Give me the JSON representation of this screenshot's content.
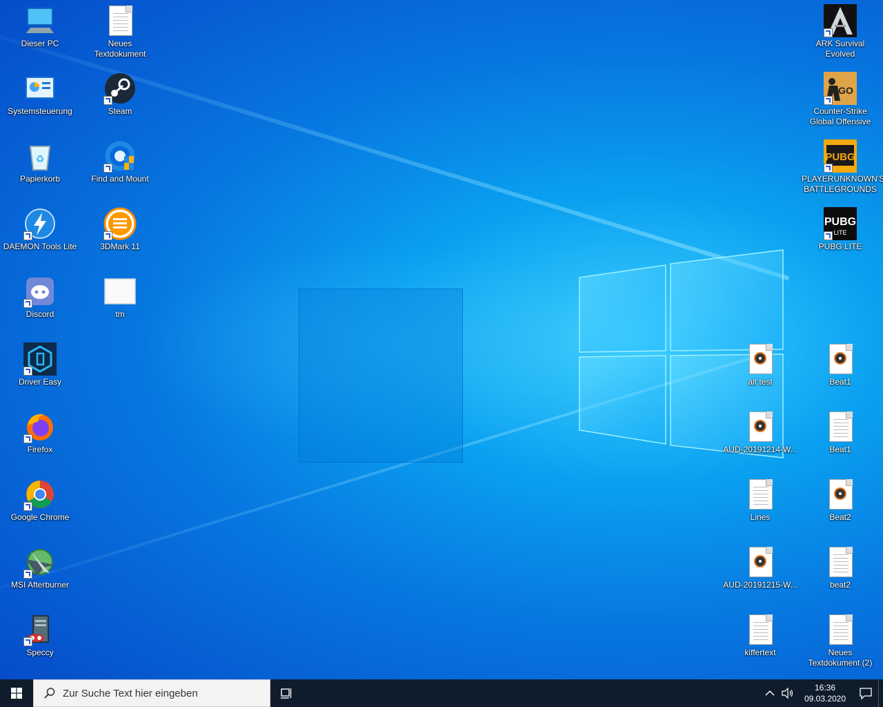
{
  "desktop": {
    "left_col1": [
      {
        "label": "Dieser PC",
        "icon": "computer-icon"
      },
      {
        "label": "Systemsteuerung",
        "icon": "control-panel-icon"
      },
      {
        "label": "Papierkorb",
        "icon": "recycle-bin-icon"
      },
      {
        "label": "DAEMON Tools Lite",
        "icon": "daemon-tools-icon"
      },
      {
        "label": "Discord",
        "icon": "discord-icon"
      },
      {
        "label": "Driver Easy",
        "icon": "driver-easy-icon"
      },
      {
        "label": "Firefox",
        "icon": "firefox-icon"
      },
      {
        "label": "Google Chrome",
        "icon": "chrome-icon"
      },
      {
        "label": "MSI Afterburner",
        "icon": "msi-afterburner-icon"
      },
      {
        "label": "Speccy",
        "icon": "speccy-icon"
      }
    ],
    "left_col2": [
      {
        "label": "Neues Textdokument",
        "icon": "text-document-icon"
      },
      {
        "label": "Steam",
        "icon": "steam-icon"
      },
      {
        "label": "Find and Mount",
        "icon": "find-and-mount-icon"
      },
      {
        "label": "3DMark 11",
        "icon": "3dmark-icon"
      },
      {
        "label": "tm",
        "icon": "image-file-icon"
      }
    ],
    "right_games": [
      {
        "label": "ARK Survival Evolved",
        "icon": "ark-icon"
      },
      {
        "label": "Counter-Strike Global Offensive",
        "icon": "csgo-icon"
      },
      {
        "label": "PLAYERUNKNOWN'S BATTLEGROUNDS",
        "icon": "pubg-icon"
      },
      {
        "label": "PUBG LITE",
        "icon": "pubg-lite-icon"
      }
    ],
    "right_files_col1": [
      {
        "label": "alt test",
        "icon": "audio-file-icon"
      },
      {
        "label": "AUD-20191214-W...",
        "icon": "audio-file-icon"
      },
      {
        "label": "Lines",
        "icon": "text-document-icon"
      },
      {
        "label": "AUD-20191215-W...",
        "icon": "audio-file-icon"
      },
      {
        "label": "kiffertext",
        "icon": "text-document-icon"
      }
    ],
    "right_files_col2": [
      {
        "label": "Beat1",
        "icon": "audio-file-icon"
      },
      {
        "label": "Beat1",
        "icon": "text-document-icon"
      },
      {
        "label": "Beat2",
        "icon": "audio-file-icon"
      },
      {
        "label": "beat2",
        "icon": "text-document-icon"
      },
      {
        "label": "Neues Textdokument (2)",
        "icon": "text-document-icon"
      }
    ]
  },
  "taskbar": {
    "search_placeholder": "Zur Suche Text hier eingeben",
    "time": "16:36",
    "date": "09.03.2020",
    "start_icon": "windows-logo-icon",
    "taskview_icon": "task-view-icon",
    "tray_icons": [
      "chevron-up-icon",
      "volume-icon",
      "notification-icon"
    ]
  },
  "colors": {
    "taskbar_bg": "#0e1c2b",
    "desktop_accent": "#0a8cf0",
    "selection": "#0078d7"
  }
}
